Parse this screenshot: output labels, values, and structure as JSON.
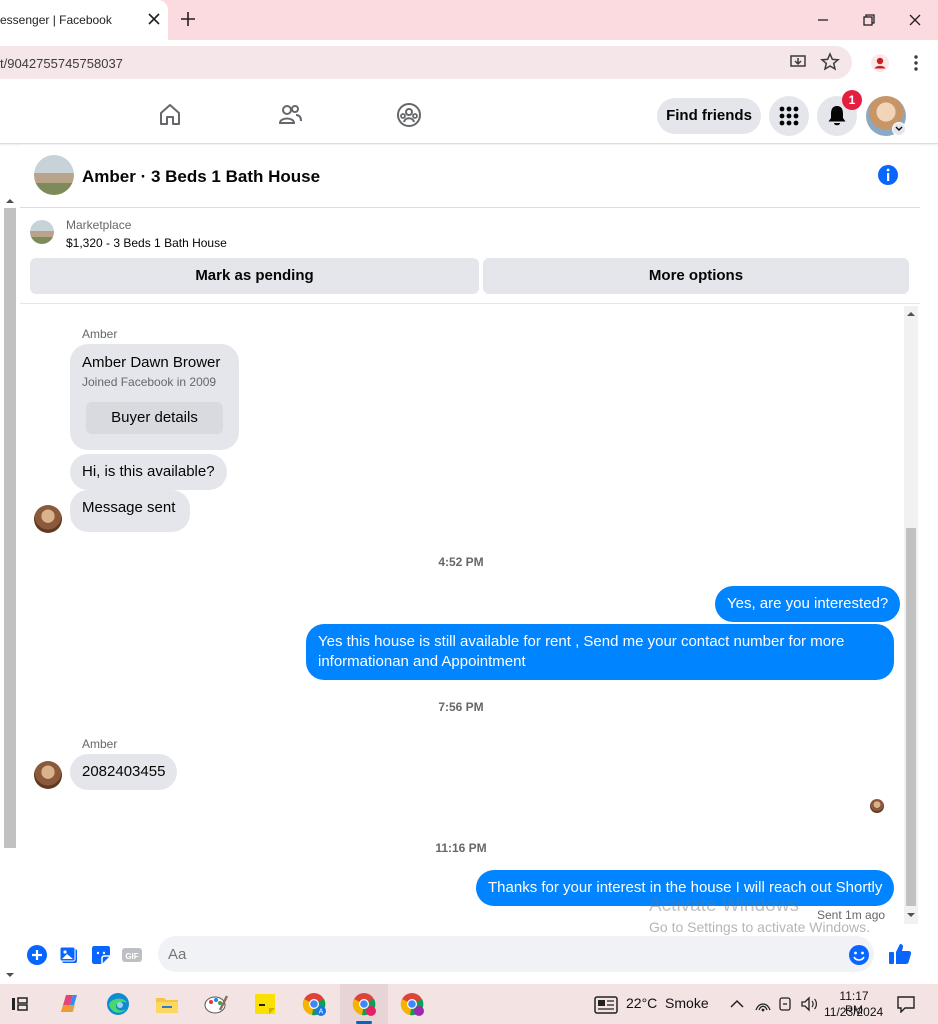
{
  "browser": {
    "tab_title": "essenger | Facebook",
    "url": "t/9042755745758037"
  },
  "nav": {
    "find_friends_label": "Find friends",
    "notification_count": "1"
  },
  "chat": {
    "title": "Amber · 3 Beds 1 Bath House",
    "marketplace_label": "Marketplace",
    "listing_price_title": "$1,320 - 3 Beds 1 Bath House",
    "mark_pending_label": "Mark as pending",
    "more_options_label": "More options"
  },
  "profile_card": {
    "sender": "Amber",
    "name": "Amber Dawn Brower",
    "joined": "Joined Facebook in 2009",
    "buyer_details_label": "Buyer details"
  },
  "messages": {
    "in_1": "Hi, is this available?",
    "in_2": "Message sent",
    "time_1": "4:52 PM",
    "out_1": "Yes, are you interested?",
    "out_2_line1": "Yes this house is still available for rent , Send me your contact number for more",
    "out_2_line2": "informationan and Appointment",
    "time_2": "7:56 PM",
    "sender_2": "Amber",
    "in_3": "2082403455",
    "time_3": "11:16 PM",
    "out_3": "Thanks for your interest in the house I will reach out Shortly",
    "sent_status": "Sent 1m ago"
  },
  "composer": {
    "placeholder": "Aa"
  },
  "watermark": {
    "title": "Activate Windows",
    "subtitle": "Go to Settings to activate Windows."
  },
  "taskbar": {
    "weather": "22°C  Smoke",
    "time": "11:17 PM",
    "date": "11/23/2024"
  },
  "colors": {
    "messenger_blue": "#0084ff",
    "incoming_bubble": "#e4e6eb",
    "badge_red": "#e41e3f",
    "tab_strip_pink": "#fcdbe0"
  }
}
